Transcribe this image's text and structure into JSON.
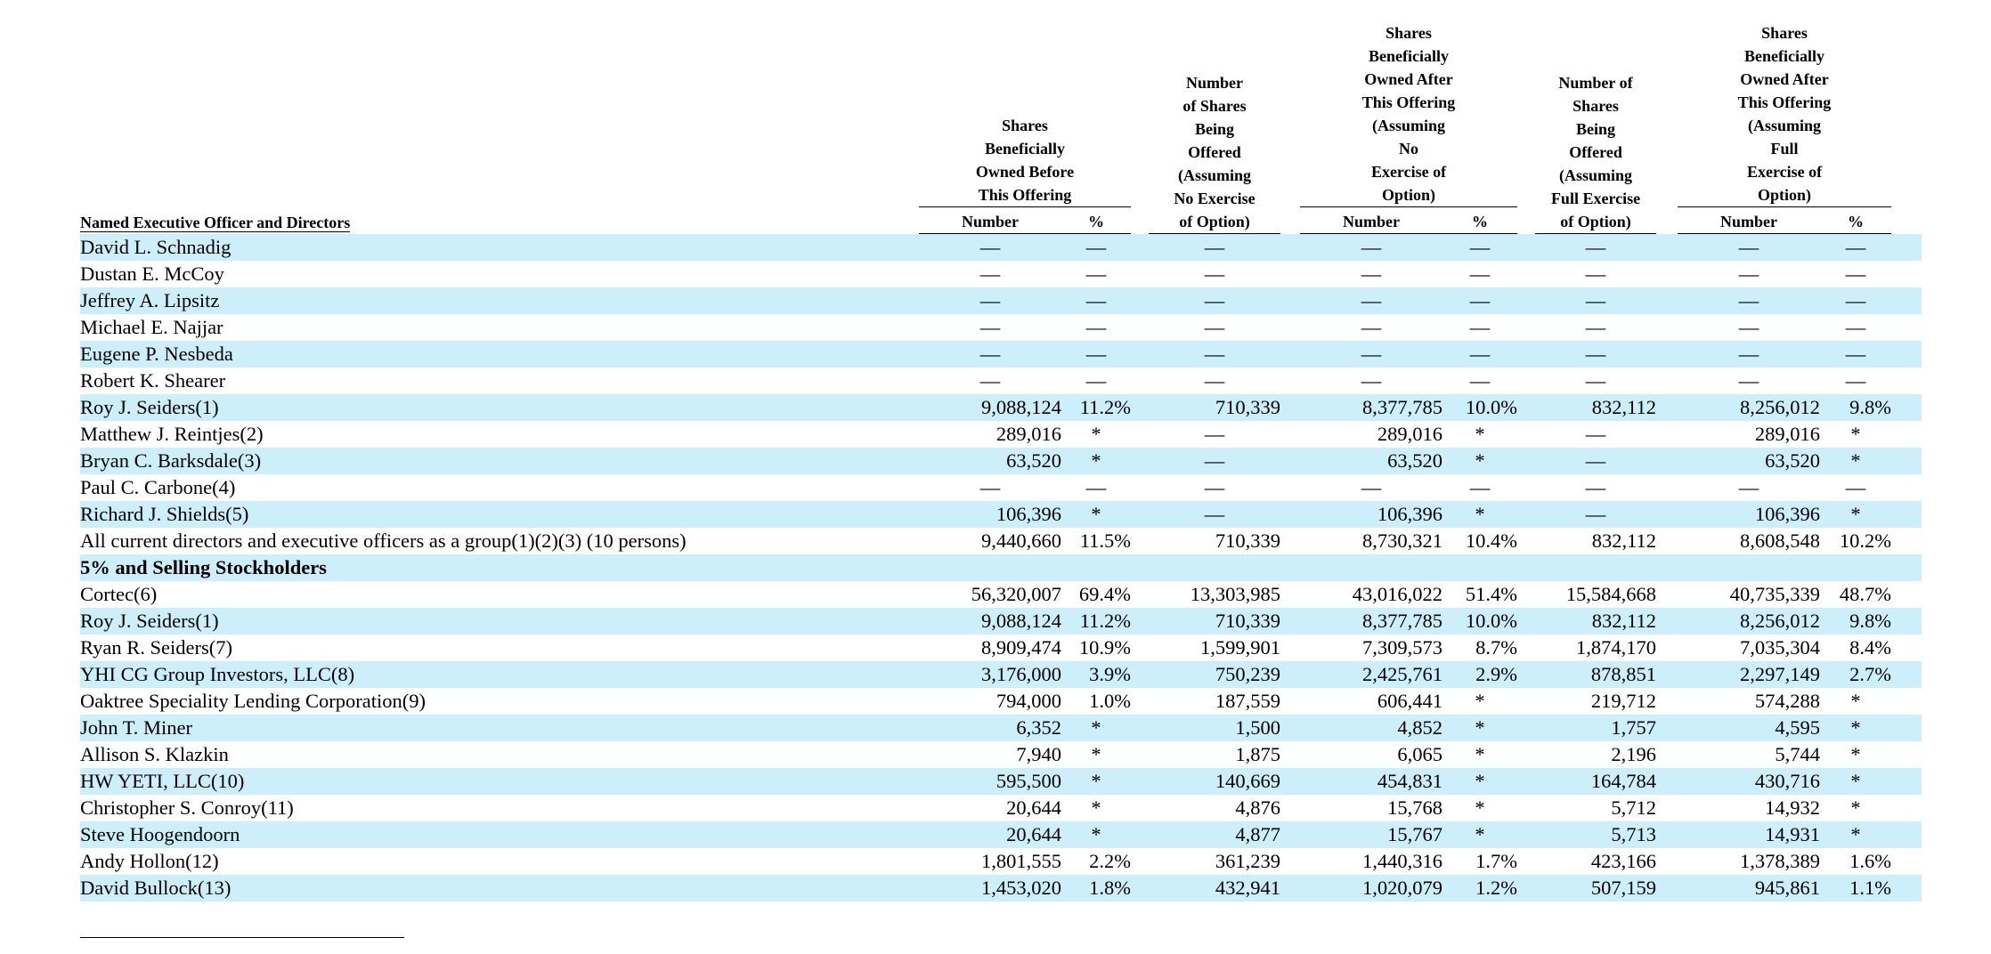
{
  "table": {
    "header": {
      "name_col": "Named Executive Officer and Directors",
      "group_before": "Shares\nBeneficially\nOwned Before\nThis Offering",
      "offered_no_option": "Number\nof Shares\nBeing\nOffered\n(Assuming\nNo Exercise\nof Option)",
      "group_after_no_option": "Shares\nBeneficially\nOwned After\nThis Offering\n(Assuming\nNo\nExercise of\nOption)",
      "offered_full_option": "Number of\nShares\nBeing\nOffered\n(Assuming\nFull Exercise\nof Option)",
      "group_after_full_option": "Shares\nBeneficially\nOwned After\nThis Offering\n(Assuming\nFull\nExercise of\nOption)",
      "sub_number": "Number",
      "sub_pct": "%"
    },
    "rows": [
      {
        "name": "David L. Schnadig",
        "v": [
          "—",
          "—",
          "—",
          "—",
          "—",
          "—",
          "—",
          "—"
        ]
      },
      {
        "name": "Dustan E. McCoy",
        "v": [
          "—",
          "—",
          "—",
          "—",
          "—",
          "—",
          "—",
          "—"
        ]
      },
      {
        "name": "Jeffrey A. Lipsitz",
        "v": [
          "—",
          "—",
          "—",
          "—",
          "—",
          "—",
          "—",
          "—"
        ]
      },
      {
        "name": "Michael E. Najjar",
        "v": [
          "—",
          "—",
          "—",
          "—",
          "—",
          "—",
          "—",
          "—"
        ]
      },
      {
        "name": "Eugene P. Nesbeda",
        "v": [
          "—",
          "—",
          "—",
          "—",
          "—",
          "—",
          "—",
          "—"
        ]
      },
      {
        "name": "Robert K. Shearer",
        "v": [
          "—",
          "—",
          "—",
          "—",
          "—",
          "—",
          "—",
          "—"
        ]
      },
      {
        "name": "Roy J. Seiders(1)",
        "v": [
          "9,088,124",
          "11.2%",
          "710,339",
          "8,377,785",
          "10.0%",
          "832,112",
          "8,256,012",
          "9.8%"
        ]
      },
      {
        "name": "Matthew J. Reintjes(2)",
        "v": [
          "289,016",
          "*",
          "—",
          "289,016",
          "*",
          "—",
          "289,016",
          "*"
        ]
      },
      {
        "name": "Bryan C. Barksdale(3)",
        "v": [
          "63,520",
          "*",
          "—",
          "63,520",
          "*",
          "—",
          "63,520",
          "*"
        ]
      },
      {
        "name": "Paul C. Carbone(4)",
        "v": [
          "—",
          "—",
          "—",
          "—",
          "—",
          "—",
          "—",
          "—"
        ]
      },
      {
        "name": "Richard J. Shields(5)",
        "v": [
          "106,396",
          "*",
          "—",
          "106,396",
          "*",
          "—",
          "106,396",
          "*"
        ]
      },
      {
        "name": "All current directors and executive officers as a group(1)(2)(3) (10 persons)",
        "v": [
          "9,440,660",
          "11.5%",
          "710,339",
          "8,730,321",
          "10.4%",
          "832,112",
          "8,608,548",
          "10.2%"
        ]
      },
      {
        "name": "5% and Selling Stockholders",
        "section": true,
        "v": [
          "",
          "",
          "",
          "",
          "",
          "",
          "",
          ""
        ]
      },
      {
        "name": "Cortec(6)",
        "v": [
          "56,320,007",
          "69.4%",
          "13,303,985",
          "43,016,022",
          "51.4%",
          "15,584,668",
          "40,735,339",
          "48.7%"
        ]
      },
      {
        "name": "Roy J. Seiders(1)",
        "v": [
          "9,088,124",
          "11.2%",
          "710,339",
          "8,377,785",
          "10.0%",
          "832,112",
          "8,256,012",
          "9.8%"
        ]
      },
      {
        "name": "Ryan R. Seiders(7)",
        "v": [
          "8,909,474",
          "10.9%",
          "1,599,901",
          "7,309,573",
          "8.7%",
          "1,874,170",
          "7,035,304",
          "8.4%"
        ]
      },
      {
        "name": "YHI CG Group Investors, LLC(8)",
        "v": [
          "3,176,000",
          "3.9%",
          "750,239",
          "2,425,761",
          "2.9%",
          "878,851",
          "2,297,149",
          "2.7%"
        ]
      },
      {
        "name": "Oaktree Speciality Lending Corporation(9)",
        "v": [
          "794,000",
          "1.0%",
          "187,559",
          "606,441",
          "*",
          "219,712",
          "574,288",
          "*"
        ]
      },
      {
        "name": "John T. Miner",
        "v": [
          "6,352",
          "*",
          "1,500",
          "4,852",
          "*",
          "1,757",
          "4,595",
          "*"
        ]
      },
      {
        "name": "Allison S. Klazkin",
        "v": [
          "7,940",
          "*",
          "1,875",
          "6,065",
          "*",
          "2,196",
          "5,744",
          "*"
        ]
      },
      {
        "name": "HW YETI, LLC(10)",
        "v": [
          "595,500",
          "*",
          "140,669",
          "454,831",
          "*",
          "164,784",
          "430,716",
          "*"
        ]
      },
      {
        "name": "Christopher S. Conroy(11)",
        "v": [
          "20,644",
          "*",
          "4,876",
          "15,768",
          "*",
          "5,712",
          "14,932",
          "*"
        ]
      },
      {
        "name": "Steve Hoogendoorn",
        "v": [
          "20,644",
          "*",
          "4,877",
          "15,767",
          "*",
          "5,713",
          "14,931",
          "*"
        ]
      },
      {
        "name": "Andy Hollon(12)",
        "v": [
          "1,801,555",
          "2.2%",
          "361,239",
          "1,440,316",
          "1.7%",
          "423,166",
          "1,378,389",
          "1.6%"
        ]
      },
      {
        "name": "David Bullock(13)",
        "v": [
          "1,453,020",
          "1.8%",
          "432,941",
          "1,020,079",
          "1.2%",
          "507,159",
          "945,861",
          "1.1%"
        ]
      }
    ]
  }
}
